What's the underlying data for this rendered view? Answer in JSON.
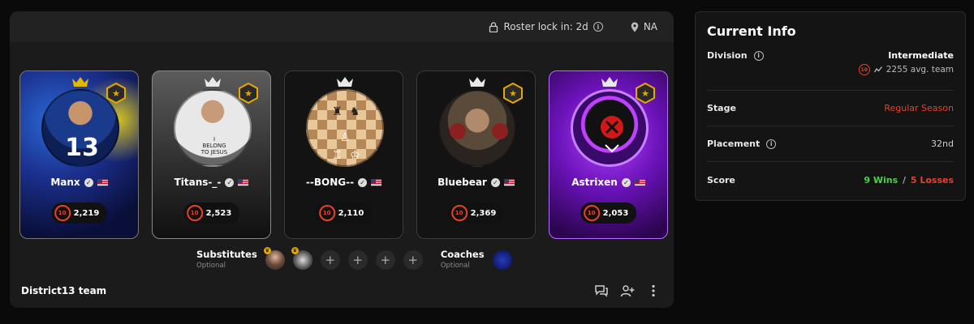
{
  "team": {
    "roster_lock": "Roster lock in: 2d",
    "region": "NA",
    "name": "District13 team"
  },
  "players": [
    {
      "name": "Manx",
      "elo": "2,219",
      "level": "10",
      "flag": "us-flag-icon"
    },
    {
      "name": "Titans-_-",
      "elo": "2,523",
      "level": "10",
      "flag": "us-flag-icon"
    },
    {
      "name": "--BONG--",
      "elo": "2,110",
      "level": "10",
      "flag": "us-flag-icon"
    },
    {
      "name": "Bluebear",
      "elo": "2,369",
      "level": "10",
      "flag": "us-flag-icon"
    },
    {
      "name": "Astrixen",
      "elo": "2,053",
      "level": "10",
      "flag": "us-flag-icon"
    }
  ],
  "substitutes": {
    "title": "Substitutes",
    "subtitle": "Optional"
  },
  "coaches": {
    "title": "Coaches",
    "subtitle": "Optional"
  },
  "info": {
    "title": "Current Info",
    "division_label": "Division",
    "division_value": "Intermediate",
    "division_level": "10",
    "avg_team": "2255 avg. team",
    "stage_label": "Stage",
    "stage_value": "Regular Season",
    "placement_label": "Placement",
    "placement_value": "32nd",
    "score_label": "Score",
    "wins": "9 Wins",
    "separator": "/",
    "losses": "5 Losses"
  },
  "colors": {
    "accent": "#e8412b",
    "win": "#4cd14c",
    "gold": "#e5a800"
  }
}
